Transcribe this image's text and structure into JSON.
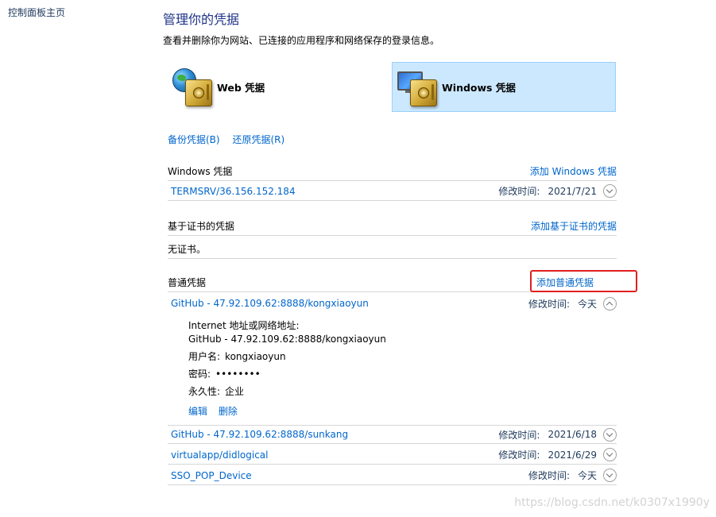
{
  "nav": {
    "control_panel_home": "控制面板主页"
  },
  "header": {
    "title": "管理你的凭据",
    "subtitle": "查看并删除你为网站、已连接的应用程序和网络保存的登录信息。"
  },
  "cred_types": {
    "web": "Web 凭据",
    "windows": "Windows 凭据"
  },
  "backup": {
    "backup_label": "备份凭据(B)",
    "restore_label": "还原凭据(R)"
  },
  "windows_section": {
    "title": "Windows 凭据",
    "add_label": "添加 Windows 凭据",
    "items": [
      {
        "name": "TERMSRV/36.156.152.184",
        "date_label": "修改时间:",
        "date": "2021/7/21"
      }
    ]
  },
  "cert_section": {
    "title": "基于证书的凭据",
    "add_label": "添加基于证书的凭据",
    "empty": "无证书。"
  },
  "generic_section": {
    "title": "普通凭据",
    "add_label": "添加普通凭据",
    "expanded_item": {
      "name": "GitHub - 47.92.109.62:8888/kongxiaoyun",
      "date_label": "修改时间:",
      "date": "今天",
      "address_label": "Internet 地址或网络地址:",
      "address": "GitHub - 47.92.109.62:8888/kongxiaoyun",
      "username_label": "用户名:",
      "username": "kongxiaoyun",
      "password_label": "密码:",
      "password": "••••••••",
      "persistence_label": "永久性:",
      "persistence": "企业",
      "edit_label": "编辑",
      "delete_label": "删除"
    },
    "items": [
      {
        "name": "GitHub - 47.92.109.62:8888/sunkang",
        "date_label": "修改时间:",
        "date": "2021/6/18"
      },
      {
        "name": "virtualapp/didlogical",
        "date_label": "修改时间:",
        "date": "2021/6/29"
      },
      {
        "name": "SSO_POP_Device",
        "date_label": "修改时间:",
        "date": "今天"
      }
    ]
  },
  "watermark": "https://blog.csdn.net/k0307x1990y"
}
